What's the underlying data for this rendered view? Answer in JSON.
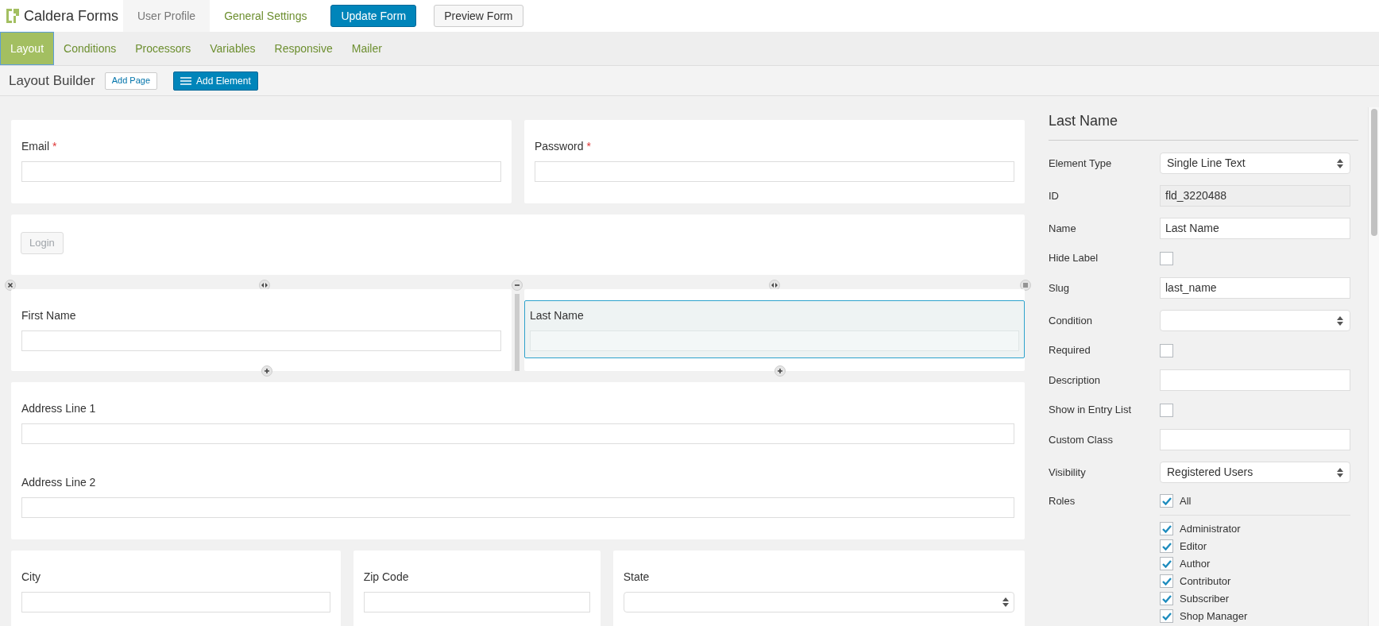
{
  "brand": {
    "name": "Caldera Forms"
  },
  "top_nav": [
    {
      "label": "User Profile",
      "selected": true
    },
    {
      "label": "General Settings",
      "selected": false
    }
  ],
  "top_buttons": [
    {
      "label": "Update Form",
      "kind": "primary"
    },
    {
      "label": "Preview Form",
      "kind": "secondary"
    }
  ],
  "tabs": [
    {
      "label": "Layout",
      "selected": true
    },
    {
      "label": "Conditions",
      "selected": false
    },
    {
      "label": "Processors",
      "selected": false
    },
    {
      "label": "Variables",
      "selected": false
    },
    {
      "label": "Responsive",
      "selected": false
    },
    {
      "label": "Mailer",
      "selected": false
    }
  ],
  "toolbar": {
    "title": "Layout Builder",
    "add_page": "Add Page",
    "add_element": "Add Element"
  },
  "rows": [
    {
      "hovered": false,
      "columns": [
        [
          {
            "kind": "text",
            "label": "Email",
            "required_mark": "*",
            "selected": false
          }
        ],
        [
          {
            "kind": "text",
            "label": "Password",
            "required_mark": "*",
            "selected": false
          }
        ]
      ]
    },
    {
      "hovered": false,
      "columns": [
        [
          {
            "kind": "button",
            "label": "Login"
          }
        ]
      ]
    },
    {
      "hovered": true,
      "columns": [
        [
          {
            "kind": "text",
            "label": "First Name",
            "selected": false
          }
        ],
        [
          {
            "kind": "text",
            "label": "Last Name",
            "selected": true
          }
        ]
      ]
    },
    {
      "hovered": false,
      "columns": [
        [
          {
            "kind": "text",
            "label": "Address Line 1",
            "selected": false
          },
          {
            "kind": "text",
            "label": "Address Line 2",
            "selected": false
          }
        ]
      ]
    },
    {
      "hovered": false,
      "columns": [
        [
          {
            "kind": "text",
            "label": "City",
            "selected": false
          }
        ],
        [
          {
            "kind": "text",
            "label": "Zip Code",
            "selected": false
          }
        ],
        [
          {
            "kind": "select",
            "label": "State",
            "selected": false
          }
        ]
      ]
    }
  ],
  "panel": {
    "title": "Last Name",
    "settings": [
      {
        "label": "Element Type",
        "kind": "select",
        "value": "Single Line Text"
      },
      {
        "label": "ID",
        "kind": "readonly",
        "value": "fld_3220488"
      },
      {
        "label": "Name",
        "kind": "text",
        "value": "Last Name"
      },
      {
        "label": "Hide Label",
        "kind": "checkbox",
        "checked": false
      },
      {
        "label": "Slug",
        "kind": "text",
        "value": "last_name"
      },
      {
        "label": "Condition",
        "kind": "select"
      },
      {
        "label": "Required",
        "kind": "checkbox",
        "checked": false
      },
      {
        "label": "Description",
        "kind": "text"
      },
      {
        "label": "Show in Entry List",
        "kind": "checkbox",
        "checked": false
      },
      {
        "label": "Custom Class",
        "kind": "text"
      },
      {
        "label": "Visibility",
        "kind": "select",
        "value": "Registered Users"
      }
    ],
    "roles": {
      "label": "Roles",
      "all": {
        "label": "All",
        "checked": true
      },
      "items": [
        {
          "label": "Administrator",
          "checked": true
        },
        {
          "label": "Editor",
          "checked": true
        },
        {
          "label": "Author",
          "checked": true
        },
        {
          "label": "Contributor",
          "checked": true
        },
        {
          "label": "Subscriber",
          "checked": true
        },
        {
          "label": "Shop Manager",
          "checked": true
        }
      ]
    }
  }
}
